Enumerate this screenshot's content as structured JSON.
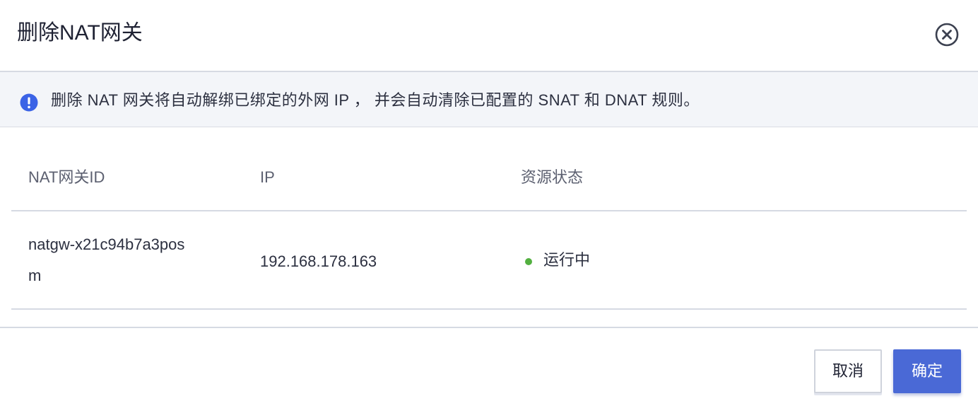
{
  "dialog": {
    "title": "删除NAT网关",
    "close_icon": "close-circle-icon"
  },
  "banner": {
    "icon": "exclamation-circle-icon",
    "text": "删除 NAT 网关将自动解绑已绑定的外网 IP ， 并会自动清除已配置的 SNAT 和 DNAT 规则。",
    "icon_color": "#3b63e6"
  },
  "table": {
    "columns": [
      "NAT网关ID",
      "IP",
      "资源状态"
    ],
    "rows": [
      {
        "id_line1": "natgw-x21c94b7a3pos",
        "id_line2": "m",
        "ip": "192.168.178.163",
        "status": "运行中",
        "status_color": "#53b040"
      }
    ]
  },
  "footer": {
    "cancel_label": "取消",
    "ok_label": "确定",
    "primary_color": "#4a69d6"
  }
}
